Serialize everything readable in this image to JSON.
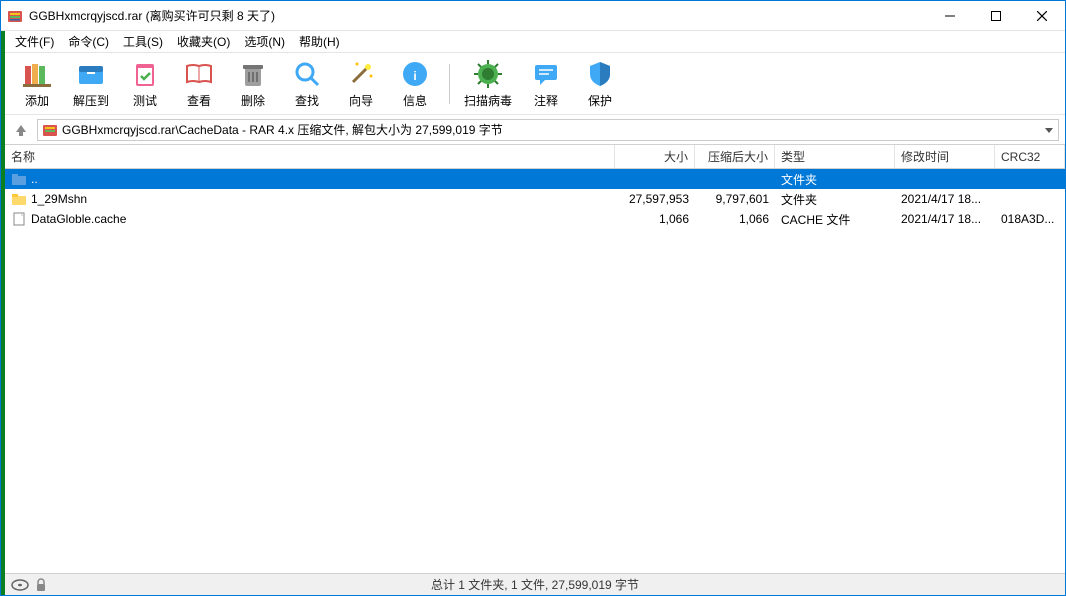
{
  "window": {
    "title": "GGBHxmcrqyjscd.rar (离购买许可只剩 8 天了)"
  },
  "menu": {
    "file": "文件(F)",
    "commands": "命令(C)",
    "tools": "工具(S)",
    "favorites": "收藏夹(O)",
    "options": "选项(N)",
    "help": "帮助(H)"
  },
  "toolbar": {
    "add": "添加",
    "extract": "解压到",
    "test": "测试",
    "view": "查看",
    "delete": "删除",
    "find": "查找",
    "wizard": "向导",
    "info": "信息",
    "virus": "扫描病毒",
    "comment": "注释",
    "protect": "保护"
  },
  "path": "GGBHxmcrqyjscd.rar\\CacheData - RAR 4.x 压缩文件, 解包大小为 27,599,019 字节",
  "columns": {
    "name": "名称",
    "size": "大小",
    "packed": "压缩后大小",
    "type": "类型",
    "mtime": "修改时间",
    "crc": "CRC32"
  },
  "rows": [
    {
      "icon": "up",
      "name": "..",
      "size": "",
      "packed": "",
      "type": "文件夹",
      "mtime": "",
      "crc": "",
      "selected": true
    },
    {
      "icon": "folder",
      "name": "1_29Mshn",
      "size": "27,597,953",
      "packed": "9,797,601",
      "type": "文件夹",
      "mtime": "2021/4/17 18...",
      "crc": "",
      "selected": false
    },
    {
      "icon": "file",
      "name": "DataGloble.cache",
      "size": "1,066",
      "packed": "1,066",
      "type": "CACHE 文件",
      "mtime": "2021/4/17 18...",
      "crc": "018A3D...",
      "selected": false
    }
  ],
  "status": {
    "summary": "总计 1 文件夹, 1 文件, 27,599,019 字节"
  }
}
